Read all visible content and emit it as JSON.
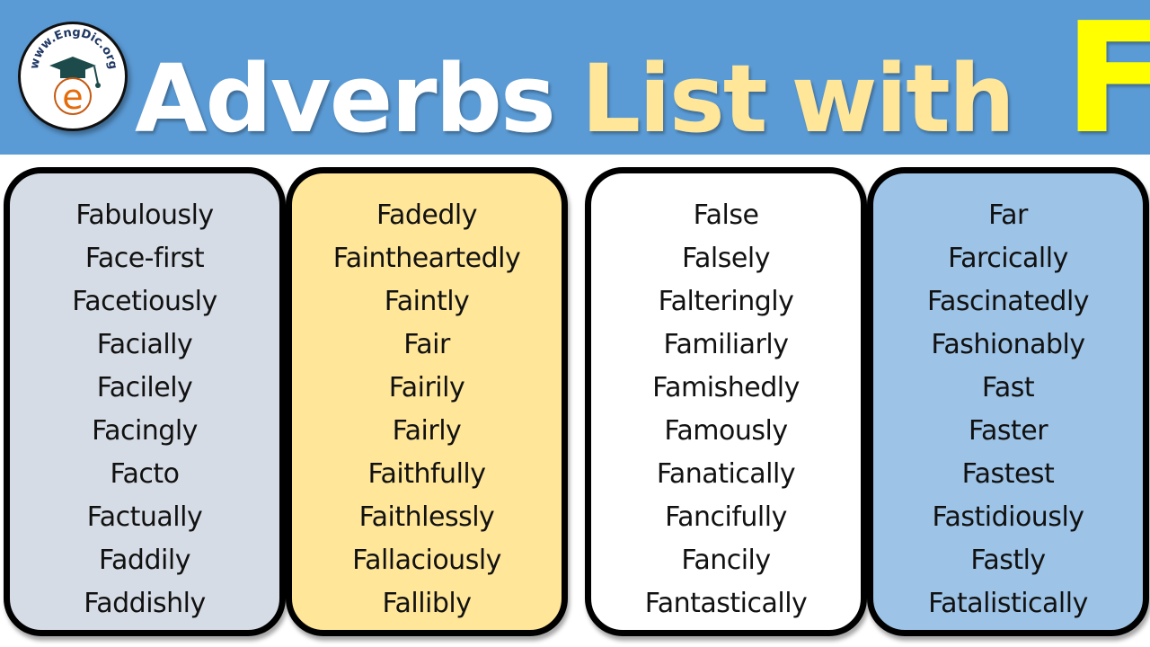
{
  "header": {
    "title_words": [
      "Adverbs",
      "List",
      "with",
      "F"
    ],
    "logo": {
      "text": "www.EngDic.org",
      "icon": "graduation-cap-icon",
      "letter": "e"
    }
  },
  "colors": {
    "banner": "#5b9bd5",
    "title_white": "#ffffff",
    "title_cream": "#ffe699",
    "title_letter": "#ffff00",
    "panel_1": "#d6dce5",
    "panel_2": "#ffe699",
    "panel_3": "#ffffff",
    "panel_4": "#9dc3e6",
    "border": "#000000"
  },
  "columns": [
    {
      "words": [
        "Fabulously",
        "Face-first",
        "Facetiously",
        "Facially",
        "Facilely",
        "Facingly",
        "Facto",
        "Factually",
        "Faddily",
        "Faddishly"
      ]
    },
    {
      "words": [
        "Fadedly",
        "Faintheartedly",
        "Faintly",
        "Fair",
        "Fairily",
        "Fairly",
        "Faithfully",
        "Faithlessly",
        "Fallaciously",
        "Fallibly"
      ]
    },
    {
      "words": [
        "False",
        "Falsely",
        "Falteringly",
        "Familiarly",
        "Famishedly",
        "Famously",
        "Fanatically",
        "Fancifully",
        "Fancily",
        "Fantastically"
      ]
    },
    {
      "words": [
        "Far",
        "Farcically",
        "Fascinatedly",
        "Fashionably",
        "Fast",
        "Faster",
        "Fastest",
        "Fastidiously",
        "Fastly",
        "Fatalistically"
      ]
    }
  ]
}
